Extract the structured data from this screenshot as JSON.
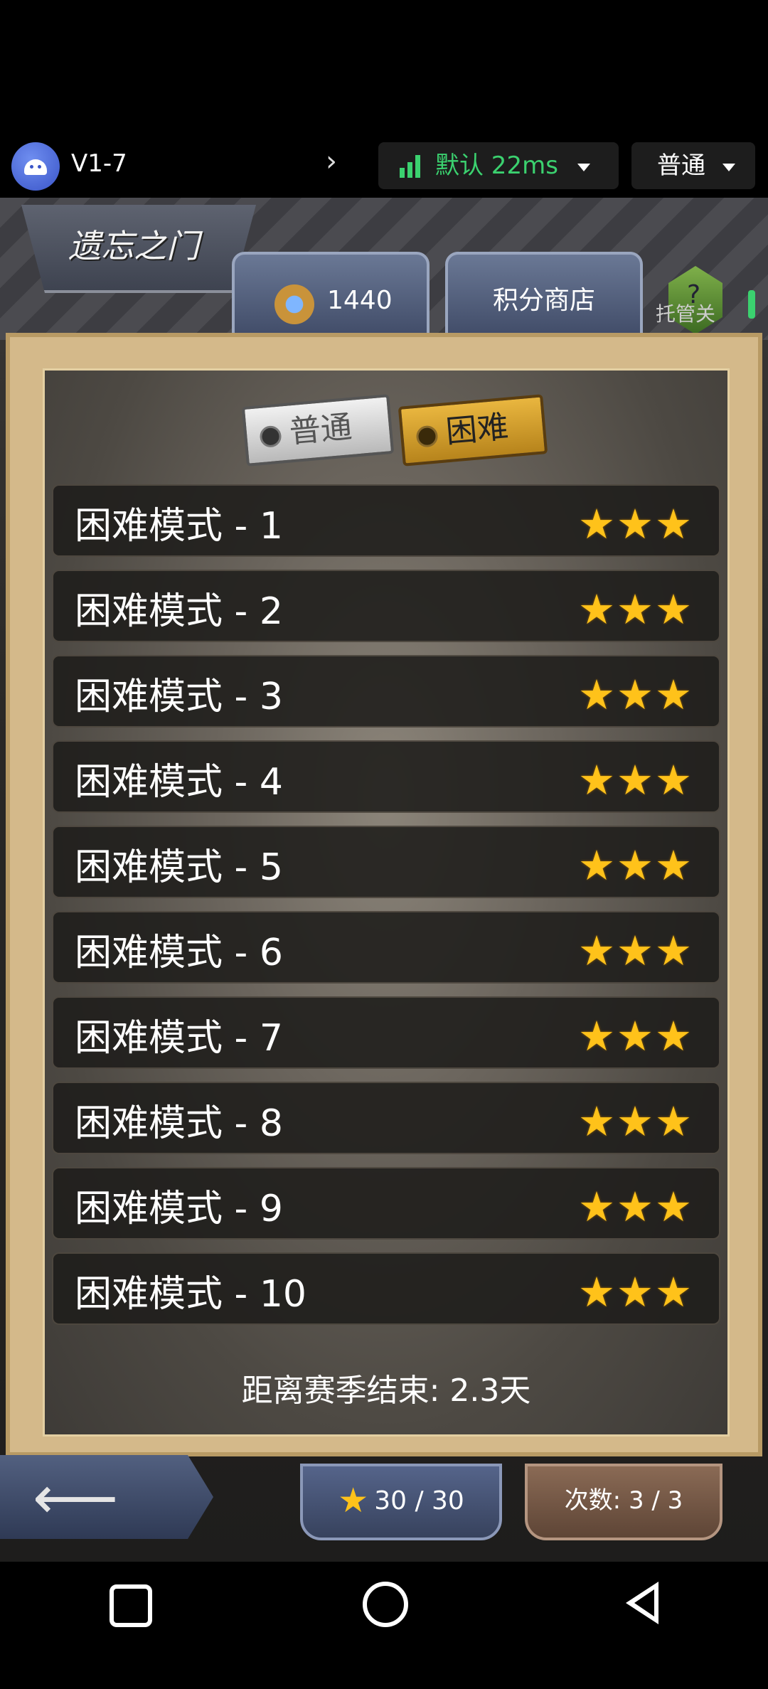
{
  "topbar": {
    "app_name": "V1-7",
    "chevron": "›",
    "network": "默认 22ms",
    "mode": "普通",
    "icons": {
      "app": "android-icon",
      "signal": "signal-bars-icon",
      "dropdown": "caret-down-icon"
    },
    "network_color": "#3bd16f"
  },
  "game": {
    "title": "遗忘之门",
    "points_value": "1440",
    "shop_label": "积分商店",
    "help_glyph": "?",
    "auto_label": "托管关",
    "tabs": {
      "normal": "普通",
      "hard": "困难",
      "active": "hard"
    },
    "levels": [
      {
        "name": "困难模式 - 1",
        "stars": "★★★"
      },
      {
        "name": "困难模式 - 2",
        "stars": "★★★"
      },
      {
        "name": "困难模式 - 3",
        "stars": "★★★"
      },
      {
        "name": "困难模式 - 4",
        "stars": "★★★"
      },
      {
        "name": "困难模式 - 5",
        "stars": "★★★"
      },
      {
        "name": "困难模式 - 6",
        "stars": "★★★"
      },
      {
        "name": "困难模式 - 7",
        "stars": "★★★"
      },
      {
        "name": "困难模式 - 8",
        "stars": "★★★"
      },
      {
        "name": "困难模式 - 9",
        "stars": "★★★"
      },
      {
        "name": "困难模式 - 10",
        "stars": "★★★"
      }
    ],
    "season_end": "距离赛季结束: 2.3天",
    "back_arrow": "⟵",
    "star_total": "30 / 30",
    "star_glyph": "★",
    "tries": "次数: 3 / 3"
  },
  "navbar": {
    "icons": [
      "recents-icon",
      "home-icon",
      "back-icon"
    ]
  }
}
